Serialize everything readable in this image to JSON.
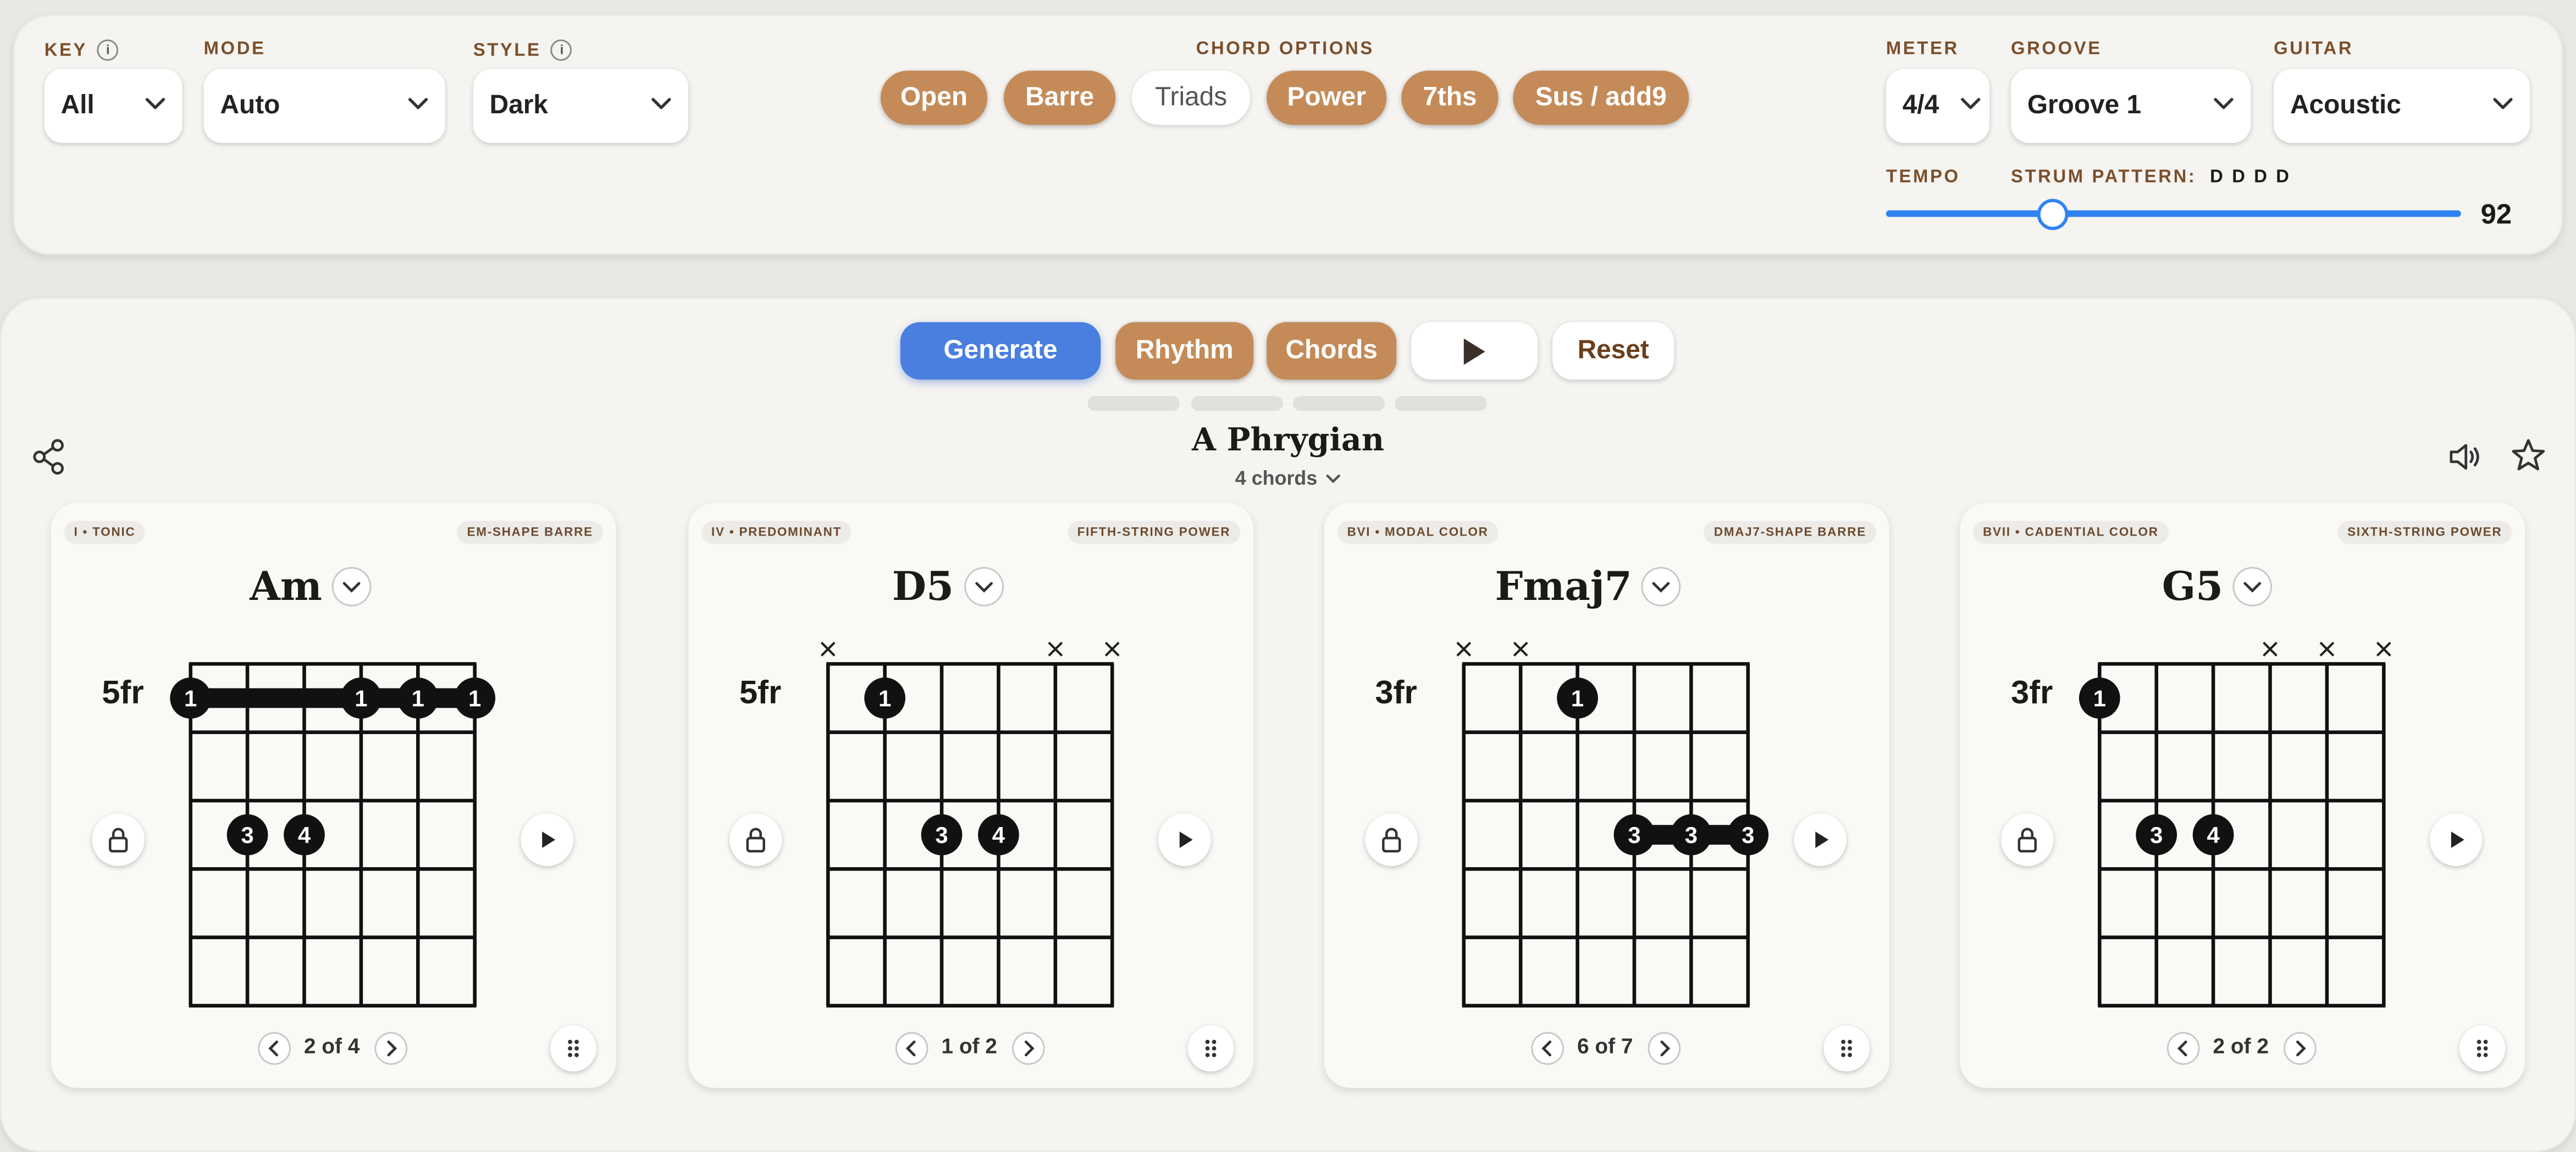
{
  "top_panel": {
    "key": {
      "label": "KEY",
      "info": "i",
      "value": "All"
    },
    "mode": {
      "label": "MODE",
      "value": "Auto"
    },
    "style": {
      "label": "STYLE",
      "info": "i",
      "value": "Dark"
    },
    "chord_options": {
      "label": "CHORD OPTIONS",
      "options": [
        {
          "label": "Open",
          "selected": true
        },
        {
          "label": "Barre",
          "selected": true
        },
        {
          "label": "Triads",
          "selected": false
        },
        {
          "label": "Power",
          "selected": true
        },
        {
          "label": "7ths",
          "selected": true
        },
        {
          "label": "Sus / add9",
          "selected": true
        }
      ]
    },
    "meter": {
      "label": "METER",
      "value": "4/4"
    },
    "groove": {
      "label": "GROOVE",
      "value": "Groove 1"
    },
    "guitar": {
      "label": "GUITAR",
      "value": "Acoustic"
    },
    "tempo": {
      "label": "TEMPO",
      "value": "92",
      "min": 40,
      "max": 220
    },
    "strum": {
      "label": "STRUM PATTERN:",
      "value": "D D D D"
    }
  },
  "actions": {
    "generate": "Generate",
    "rhythm": "Rhythm",
    "chords": "Chords",
    "reset": "Reset"
  },
  "progression": {
    "title": "A Phrygian",
    "subtitle": "4 chords"
  },
  "colors": {
    "accent_brown": "#c48b58",
    "primary_blue": "#4a7fe0",
    "slider_blue": "#2f83f2",
    "label_brown": "#7a4f2b"
  },
  "cards": [
    {
      "function": "I • TONIC",
      "shape": "EM-SHAPE BARRE",
      "name": "Am",
      "fret_label": "5fr",
      "pager": "2 of 4"
    },
    {
      "function": "IV • PREDOMINANT",
      "shape": "FIFTH-STRING POWER",
      "name": "D5",
      "fret_label": "5fr",
      "pager": "1 of 2"
    },
    {
      "function": "BVI • MODAL COLOR",
      "shape": "DMAJ7-SHAPE BARRE",
      "name": "Fmaj7",
      "fret_label": "3fr",
      "pager": "6 of 7"
    },
    {
      "function": "BVII • CADENTIAL COLOR",
      "shape": "SIXTH-STRING POWER",
      "name": "G5",
      "fret_label": "3fr",
      "pager": "2 of 2"
    }
  ],
  "diagrams": [
    {
      "muted": [],
      "barres": [
        {
          "fret": 1,
          "from": 0,
          "to": 5
        }
      ],
      "dots": [
        {
          "string": 0,
          "fret": 1,
          "finger": "1"
        },
        {
          "string": 3,
          "fret": 1,
          "finger": "1"
        },
        {
          "string": 4,
          "fret": 1,
          "finger": "1"
        },
        {
          "string": 5,
          "fret": 1,
          "finger": "1"
        },
        {
          "string": 1,
          "fret": 3,
          "finger": "3"
        },
        {
          "string": 2,
          "fret": 3,
          "finger": "4"
        }
      ]
    },
    {
      "muted": [
        0,
        4,
        5
      ],
      "barres": [],
      "dots": [
        {
          "string": 1,
          "fret": 1,
          "finger": "1"
        },
        {
          "string": 2,
          "fret": 3,
          "finger": "3"
        },
        {
          "string": 3,
          "fret": 3,
          "finger": "4"
        }
      ]
    },
    {
      "muted": [
        0,
        1
      ],
      "barres": [
        {
          "fret": 3,
          "from": 3,
          "to": 5
        }
      ],
      "dots": [
        {
          "string": 2,
          "fret": 1,
          "finger": "1"
        },
        {
          "string": 3,
          "fret": 3,
          "finger": "3"
        },
        {
          "string": 4,
          "fret": 3,
          "finger": "3"
        },
        {
          "string": 5,
          "fret": 3,
          "finger": "3"
        }
      ]
    },
    {
      "muted": [
        3,
        4,
        5
      ],
      "barres": [],
      "dots": [
        {
          "string": 0,
          "fret": 1,
          "finger": "1"
        },
        {
          "string": 1,
          "fret": 3,
          "finger": "3"
        },
        {
          "string": 2,
          "fret": 3,
          "finger": "4"
        }
      ]
    }
  ]
}
